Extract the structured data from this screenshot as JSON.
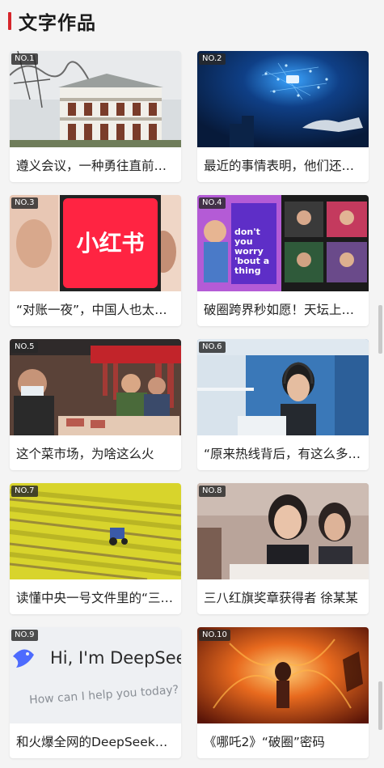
{
  "header": {
    "title": "文字作品"
  },
  "cards": [
    {
      "rank": "NO.1",
      "title": "遵义会议，一种勇往直前的精神"
    },
    {
      "rank": "NO.2",
      "title": "最近的事情表明，他们还不死心"
    },
    {
      "rank": "NO.3",
      "title": "“对账一夜”，中国人也太会了"
    },
    {
      "rank": "NO.4",
      "title": "破圈跨界秒如愿！天坛上新啦"
    },
    {
      "rank": "NO.5",
      "title": "这个菜市场，为啥这么火"
    },
    {
      "rank": "NO.6",
      "title": "“原来热线背后，有这么多故事”"
    },
    {
      "rank": "NO.7",
      "title": "读懂中央一号文件里的“三农”"
    },
    {
      "rank": "NO.8",
      "title": "三八红旗奖章获得者 徐某某"
    },
    {
      "rank": "NO.9",
      "title": "和火爆全网的DeepSeek聊了聊"
    },
    {
      "rank": "NO.10",
      "title": "《哪吒2》“破圈”密码"
    }
  ],
  "thumbs": {
    "xhs_logo": "小红书",
    "dont_worry": "don't you worry 'bout a thing",
    "deepseek_hi": "Hi, I'm DeepSee",
    "deepseek_help": "How can I help you today?"
  }
}
